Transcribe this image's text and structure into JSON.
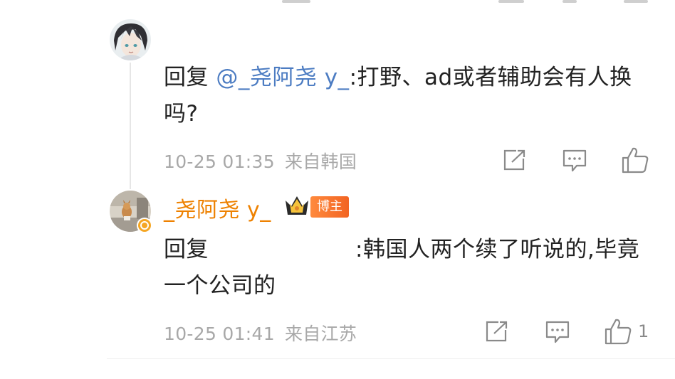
{
  "colors": {
    "mention": "#4c7cc2",
    "username_vip": "#ee8100",
    "meta_text": "#a8a8a8",
    "badge": "#f26422"
  },
  "reply1": {
    "reply_prefix": "回复",
    "mention": "@_尧阿尧 y_",
    "text": ":打野、ad或者辅助会有人换吗?",
    "time": "10-25 01:35",
    "source": "来自韩国",
    "icons": [
      "share-icon",
      "comment-icon",
      "like-icon"
    ]
  },
  "reply2": {
    "username": "_尧阿尧 y_",
    "badge": "博主",
    "reply_prefix": "回复",
    "text": ":韩国人两个续了听说的,毕竟一个公司的",
    "time": "10-25 01:41",
    "source": "来自江苏",
    "like_count": "1",
    "icons": [
      "share-icon",
      "comment-icon",
      "like-icon"
    ]
  }
}
